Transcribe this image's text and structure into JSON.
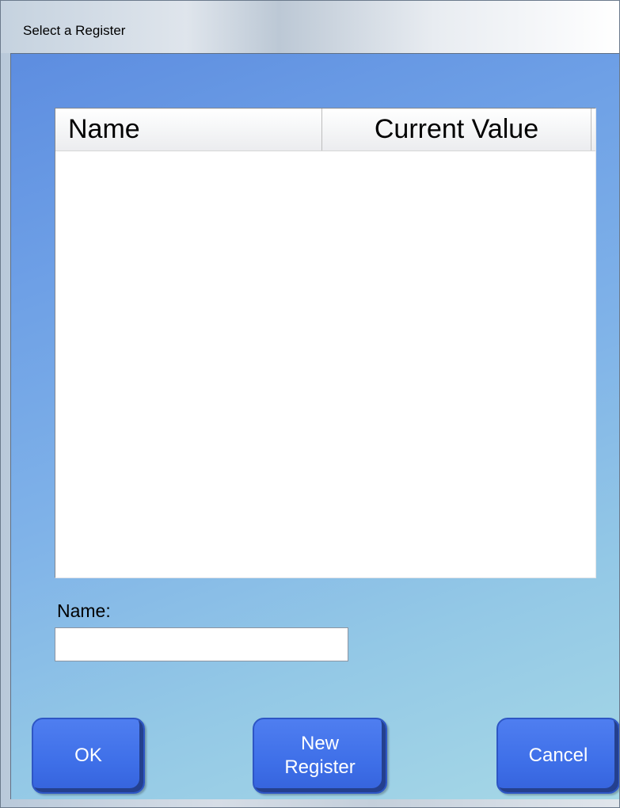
{
  "window": {
    "title": "Select a Register"
  },
  "register_list": {
    "columns": [
      "Name",
      "Current Value"
    ],
    "rows": []
  },
  "name_field": {
    "label": "Name:",
    "value": "",
    "placeholder": ""
  },
  "buttons": {
    "ok_label": "OK",
    "new_register_label": "New\nRegister",
    "cancel_label": "Cancel"
  }
}
